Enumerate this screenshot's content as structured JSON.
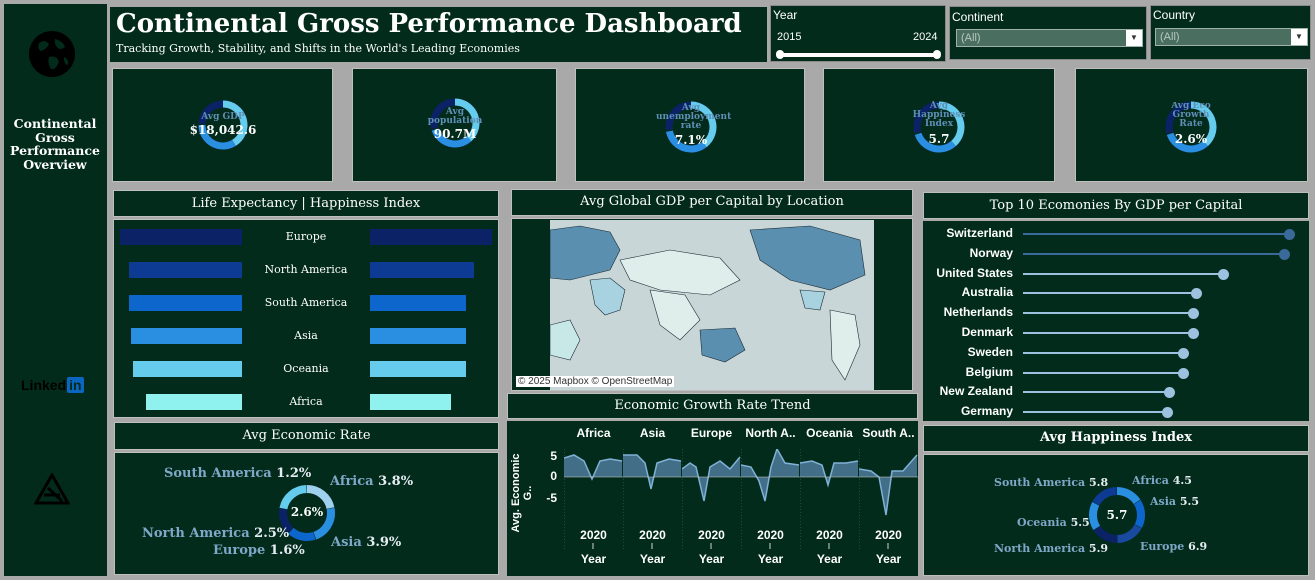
{
  "sidebar": {
    "title": "Continental Gross Performance Overview",
    "linkedin": "Linked",
    "linkedin_in": "in"
  },
  "header": {
    "title": "Continental Gross Performance Dashboard",
    "subtitle": "Tracking Growth, Stability, and Shifts in the World's Leading Economies"
  },
  "filters": {
    "year": {
      "label": "Year",
      "min": "2015",
      "max": "2024"
    },
    "continent": {
      "label": "Continent",
      "value": "(All)"
    },
    "country": {
      "label": "Country",
      "value": "(All)"
    }
  },
  "kpis": [
    {
      "label": "Avg GDP",
      "value": "$18,042.6",
      "fill": 0.75
    },
    {
      "label": "Avg population",
      "value": "90.7M",
      "fill": 0.7
    },
    {
      "label": "Avg unemployment rate",
      "value": "7.1%",
      "fill": 0.72
    },
    {
      "label": "Avg Happiness Index",
      "value": "5.7",
      "fill": 0.7
    },
    {
      "label": "Avg Eco Growth Rate",
      "value": "2.6%",
      "fill": 0.7
    }
  ],
  "life_expectancy": {
    "title": "Life Expectancy | Happiness Index",
    "rows": [
      {
        "name": "Europe",
        "life": 1.0,
        "happy": 1.0,
        "color": "#0c2266"
      },
      {
        "name": "North America",
        "life": 0.93,
        "happy": 0.85,
        "color": "#0d3a92"
      },
      {
        "name": "South America",
        "life": 0.93,
        "happy": 0.79,
        "color": "#0d66cc"
      },
      {
        "name": "Asia",
        "life": 0.91,
        "happy": 0.79,
        "color": "#2a8fe0"
      },
      {
        "name": "Oceania",
        "life": 0.89,
        "happy": 0.79,
        "color": "#66ccee"
      },
      {
        "name": "Africa",
        "life": 0.79,
        "happy": 0.66,
        "color": "#8ff2ef"
      }
    ]
  },
  "map": {
    "title": "Avg Global GDP per Capital by Location",
    "attribution": "© 2025 Mapbox © OpenStreetMap"
  },
  "top10": {
    "title": "Top 10 Ecomonies By GDP per Capital",
    "items": [
      {
        "name": "Switzerland",
        "value": 1.0
      },
      {
        "name": "Norway",
        "value": 0.98
      },
      {
        "name": "United States",
        "value": 0.75
      },
      {
        "name": "Australia",
        "value": 0.65
      },
      {
        "name": "Netherlands",
        "value": 0.64
      },
      {
        "name": "Denmark",
        "value": 0.64
      },
      {
        "name": "Sweden",
        "value": 0.6
      },
      {
        "name": "Belgium",
        "value": 0.6
      },
      {
        "name": "New Zealand",
        "value": 0.55
      },
      {
        "name": "Germany",
        "value": 0.54
      }
    ]
  },
  "econ_rate": {
    "title": "Avg Economic Rate",
    "center": "2.6%",
    "items": [
      {
        "name": "South America",
        "value": "1.2%"
      },
      {
        "name": "Africa",
        "value": "3.8%"
      },
      {
        "name": "North America",
        "value": "2.5%"
      },
      {
        "name": "Europe",
        "value": "1.6%"
      },
      {
        "name": "Asia",
        "value": "3.9%"
      }
    ]
  },
  "trend": {
    "title": "Economic Growth Rate Trend",
    "y_label": "Avg. Economic G..",
    "y_ticks": [
      "5",
      "0",
      "-5"
    ],
    "x_tick": "2020",
    "x_label": "Year",
    "panels": [
      "Africa",
      "Asia",
      "Europe",
      "North A..",
      "Oceania",
      "South A.."
    ]
  },
  "happiness": {
    "title": "Avg Happiness Index",
    "center": "5.7",
    "items": [
      {
        "name": "South America",
        "value": "5.8"
      },
      {
        "name": "Africa",
        "value": "4.5"
      },
      {
        "name": "Asia",
        "value": "5.5"
      },
      {
        "name": "Oceania",
        "value": "5.5"
      },
      {
        "name": "North America",
        "value": "5.9"
      },
      {
        "name": "Europe",
        "value": "6.9"
      }
    ]
  },
  "colors": {
    "panel": "#022b1c",
    "accent": "#2a8fe0",
    "dark_blue": "#0c2266",
    "light": "#8ff2ef"
  }
}
